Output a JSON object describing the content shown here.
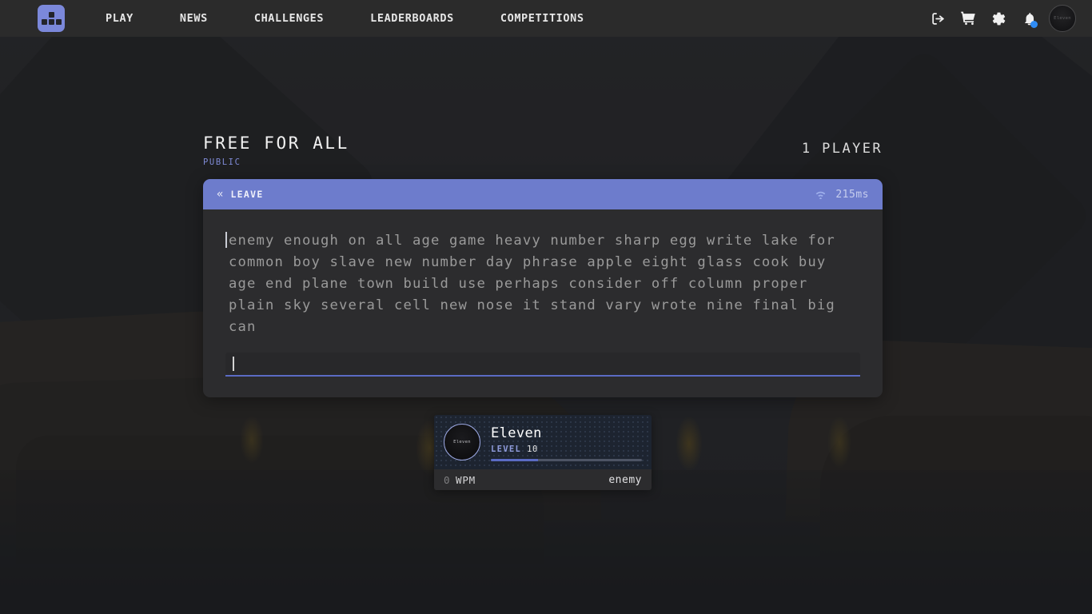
{
  "navbar": {
    "logo_name": "monkeytype-logo",
    "links": [
      {
        "label": "PLAY"
      },
      {
        "label": "NEWS"
      },
      {
        "label": "CHALLENGES"
      },
      {
        "label": "LEADERBOARDS"
      },
      {
        "label": "COMPETITIONS"
      }
    ],
    "icons": [
      {
        "name": "logout-icon"
      },
      {
        "name": "cart-icon"
      },
      {
        "name": "gear-icon"
      },
      {
        "name": "bell-icon",
        "badge": true
      }
    ],
    "avatar_text": "Eleven"
  },
  "room": {
    "title": "FREE FOR ALL",
    "visibility": "PUBLIC",
    "player_count": "1 PLAYER"
  },
  "panel": {
    "leave_chevron": "«",
    "leave_label": "LEAVE",
    "ping_icon": "wifi-icon",
    "ping": "215ms",
    "quote": "enemy enough on all age game heavy number sharp egg write lake for common boy slave new number day phrase apple eight glass cook buy age end plane town build use perhaps consider off column proper plain sky several cell new nose it stand vary wrote nine final big can",
    "input_value": "",
    "input_placeholder": ""
  },
  "player_card": {
    "avatar_text": "Eleven",
    "name": "Eleven",
    "level_label": "LEVEL",
    "level_value": "10",
    "xp_percent": 31,
    "wpm_value": "0",
    "wpm_label": "WPM",
    "role": "enemy"
  },
  "colors": {
    "accent": "#6d7ccc",
    "accent_light": "#7b88da",
    "notification": "#2f8cf5",
    "panel_bg": "#2d2d2f",
    "card_bg": "#1d2430"
  }
}
